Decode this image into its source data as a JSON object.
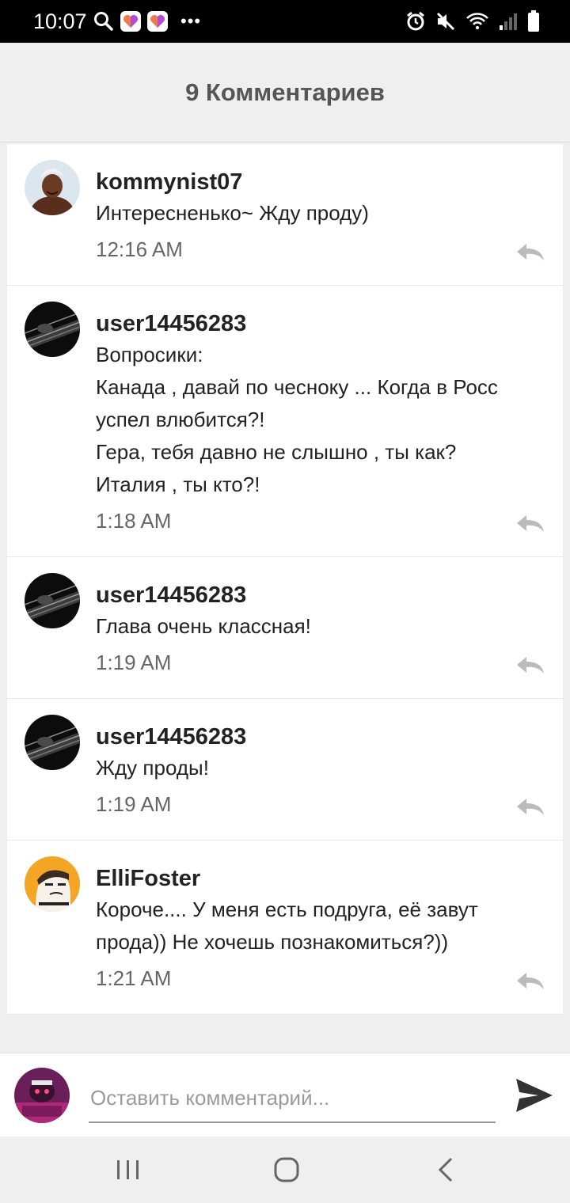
{
  "status_bar": {
    "time": "10:07",
    "left_icons": [
      "search-icon",
      "app-heart-icon",
      "app-heart-icon",
      "more-dots-icon"
    ],
    "right_icons": [
      "alarm-icon",
      "mute-icon",
      "wifi-icon",
      "signal-icon",
      "battery-icon"
    ]
  },
  "header": {
    "title": "9 Комментариев"
  },
  "comments": [
    {
      "username": "kommynist07",
      "text": "Интересненько~ Жду проду)",
      "time": "12:16 AM"
    },
    {
      "username": "user14456283",
      "text": "Вопросики:\nКанада , давай по чесноку ...  Когда в Росс успел влюбится?!\nГера, тебя давно не слышно , ты как?\nИталия , ты кто?!",
      "time": "1:18 AM"
    },
    {
      "username": "user14456283",
      "text": "Глава очень классная!",
      "time": "1:19 AM"
    },
    {
      "username": "user14456283",
      "text": "Жду проды!",
      "time": "1:19 AM"
    },
    {
      "username": "ElliFoster",
      "text": "Короче.... У меня есть подруга, её завут прода)) Не хочешь познакомиться?))",
      "time": "1:21 AM"
    }
  ],
  "composer": {
    "placeholder": "Оставить комментарий...",
    "value": ""
  },
  "colors": {
    "header_bg": "#efefef",
    "title_gray": "#555555",
    "send_gray": "#333333",
    "reply_gray": "#bbbbbb"
  }
}
